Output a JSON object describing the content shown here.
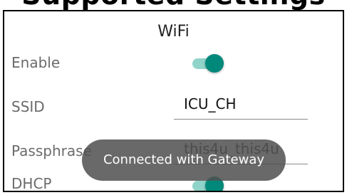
{
  "page_heading": "Supported Settings",
  "screen": {
    "title": "WiFi"
  },
  "settings": {
    "enable": {
      "label": "Enable",
      "state": "on"
    },
    "ssid": {
      "label": "SSID",
      "value": "ICU_CH"
    },
    "passphrase": {
      "label": "Passphrase",
      "value": "this4u_this4u"
    },
    "dhcp": {
      "label": "DHCP",
      "state": "on"
    }
  },
  "toast": {
    "message": "Connected with Gateway"
  },
  "colors": {
    "accent": "#00897b",
    "track": "#8fd3c9",
    "toast_bg": "#505050"
  }
}
